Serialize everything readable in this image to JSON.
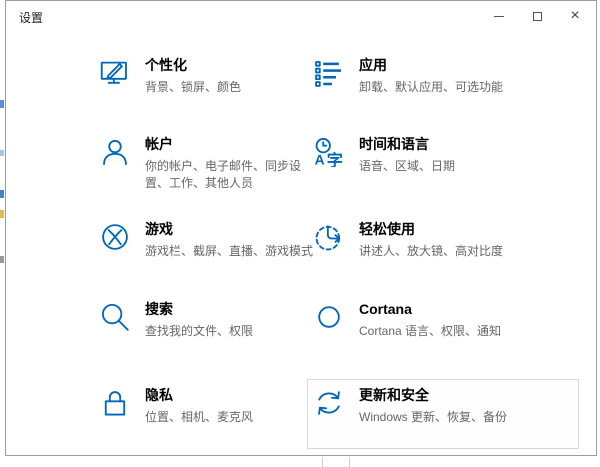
{
  "window": {
    "title": "设置",
    "controls": {
      "minimize_icon": "—",
      "maximize_icon": "▢",
      "close_icon": "×"
    }
  },
  "tiles": [
    {
      "id": "personalization",
      "icon": "personalization-icon",
      "title": "个性化",
      "subtitle": "背景、锁屏、颜色"
    },
    {
      "id": "apps",
      "icon": "apps-icon",
      "title": "应用",
      "subtitle": "卸载、默认应用、可选功能"
    },
    {
      "id": "accounts",
      "icon": "accounts-icon",
      "title": "帐户",
      "subtitle": "你的帐户、电子邮件、同步设置、工作、其他人员"
    },
    {
      "id": "time-language",
      "icon": "time-language-icon",
      "title": "时间和语言",
      "subtitle": "语音、区域、日期"
    },
    {
      "id": "gaming",
      "icon": "gaming-icon",
      "title": "游戏",
      "subtitle": "游戏栏、截屏、直播、游戏模式"
    },
    {
      "id": "ease-of-access",
      "icon": "ease-of-access-icon",
      "title": "轻松使用",
      "subtitle": "讲述人、放大镜、高对比度"
    },
    {
      "id": "search",
      "icon": "search-icon",
      "title": "搜索",
      "subtitle": "查找我的文件、权限"
    },
    {
      "id": "cortana",
      "icon": "cortana-icon",
      "title": "Cortana",
      "subtitle": "Cortana 语言、权限、通知"
    },
    {
      "id": "privacy",
      "icon": "privacy-icon",
      "title": "隐私",
      "subtitle": "位置、相机、麦克风"
    },
    {
      "id": "update-security",
      "icon": "update-security-icon",
      "title": "更新和安全",
      "subtitle": "Windows 更新、恢复、备份",
      "highlighted": true
    }
  ],
  "colors": {
    "accent": "#0067b8",
    "tile_title": "#000000",
    "tile_subtitle": "#666666",
    "highlight_border": "#d9d9d9",
    "window_border": "#9c9c9c",
    "titlebar_text": "#222222"
  }
}
